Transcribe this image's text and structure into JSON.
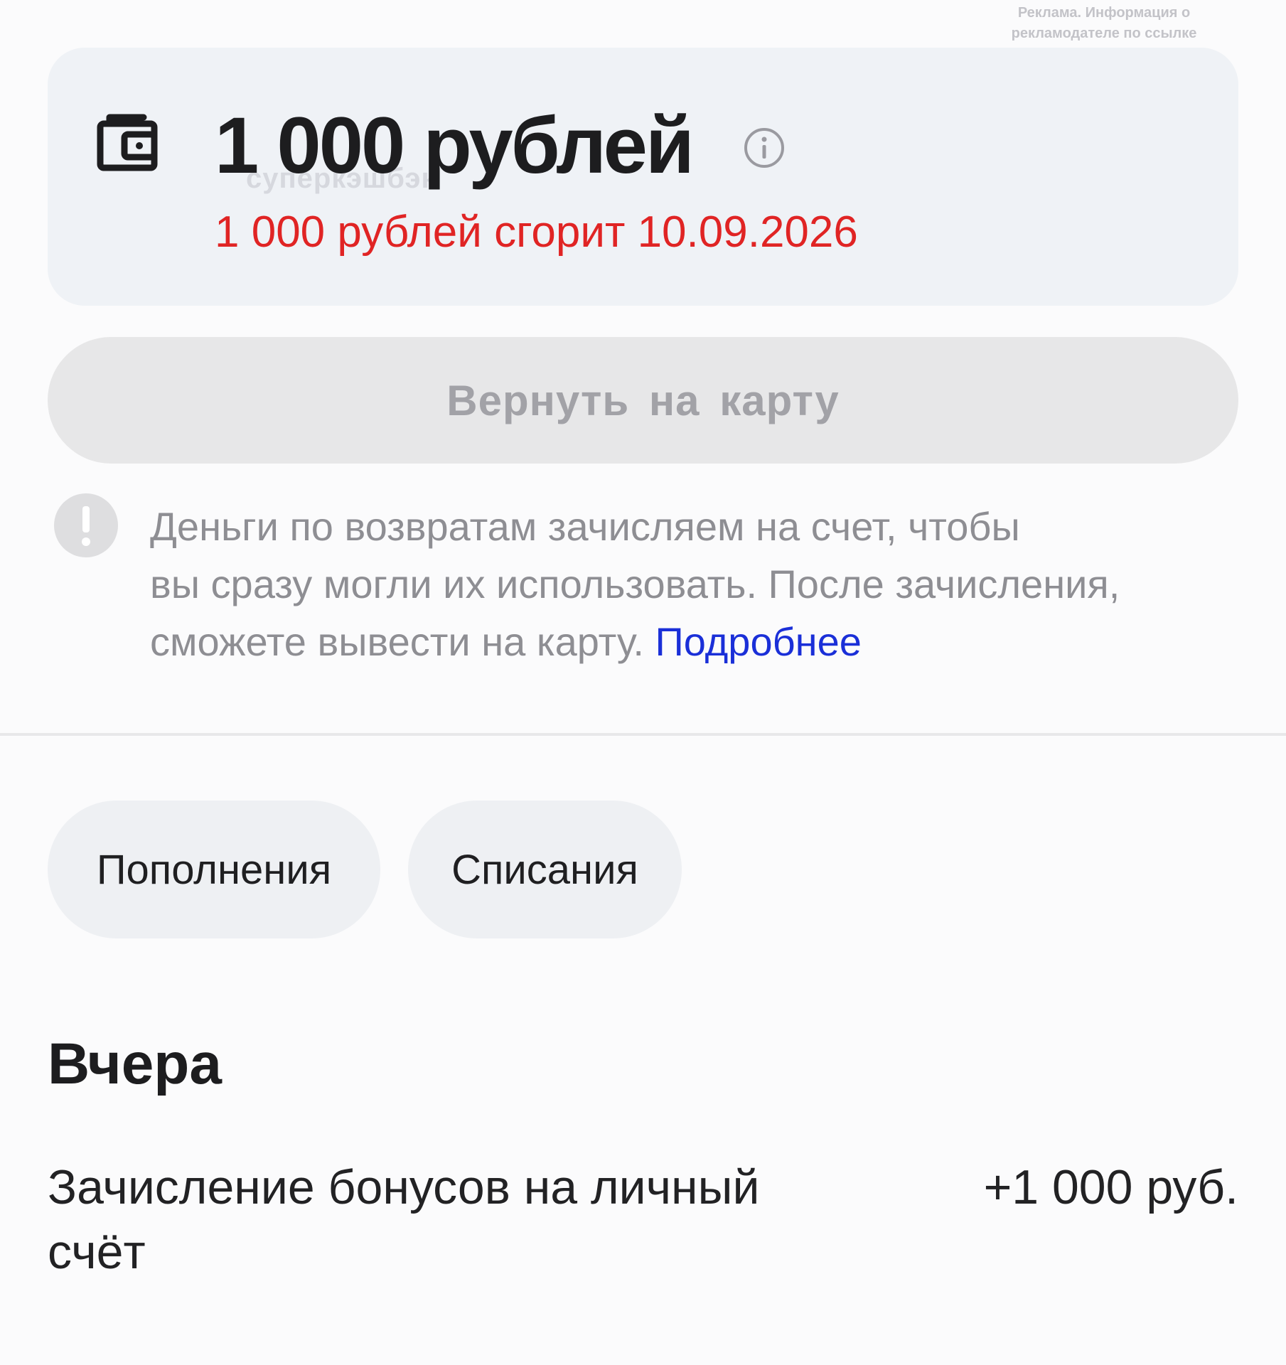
{
  "ad_note": {
    "line1": "Реклама. Информация о",
    "line2": "рекламодателе по ссылке"
  },
  "balance": {
    "icon": "wallet-icon",
    "amount": "1 000 рублей",
    "subtitle": "суперкэшбэк",
    "info_icon": "info-icon",
    "expiry": "1 000 рублей сгорит 10.09.2026",
    "expiry_color": "#e02424"
  },
  "return_button": {
    "label": "Вернуть на карту"
  },
  "notice": {
    "icon": "exclamation-icon",
    "line1": "Деньги по возвратам зачисляем на счет, чтобы",
    "line2": "вы сразу могли их использовать. После зачисления,",
    "line3_text": "сможете вывести на карту.",
    "link_label": "Подробнее",
    "link_color": "#1a2fd8"
  },
  "filters": [
    {
      "label": "Пополнения"
    },
    {
      "label": "Списания"
    }
  ],
  "history": {
    "day_label": "Вчера",
    "transactions": [
      {
        "title": "Зачисление бонусов на личный счёт",
        "amount": "+1 000 руб."
      }
    ]
  }
}
